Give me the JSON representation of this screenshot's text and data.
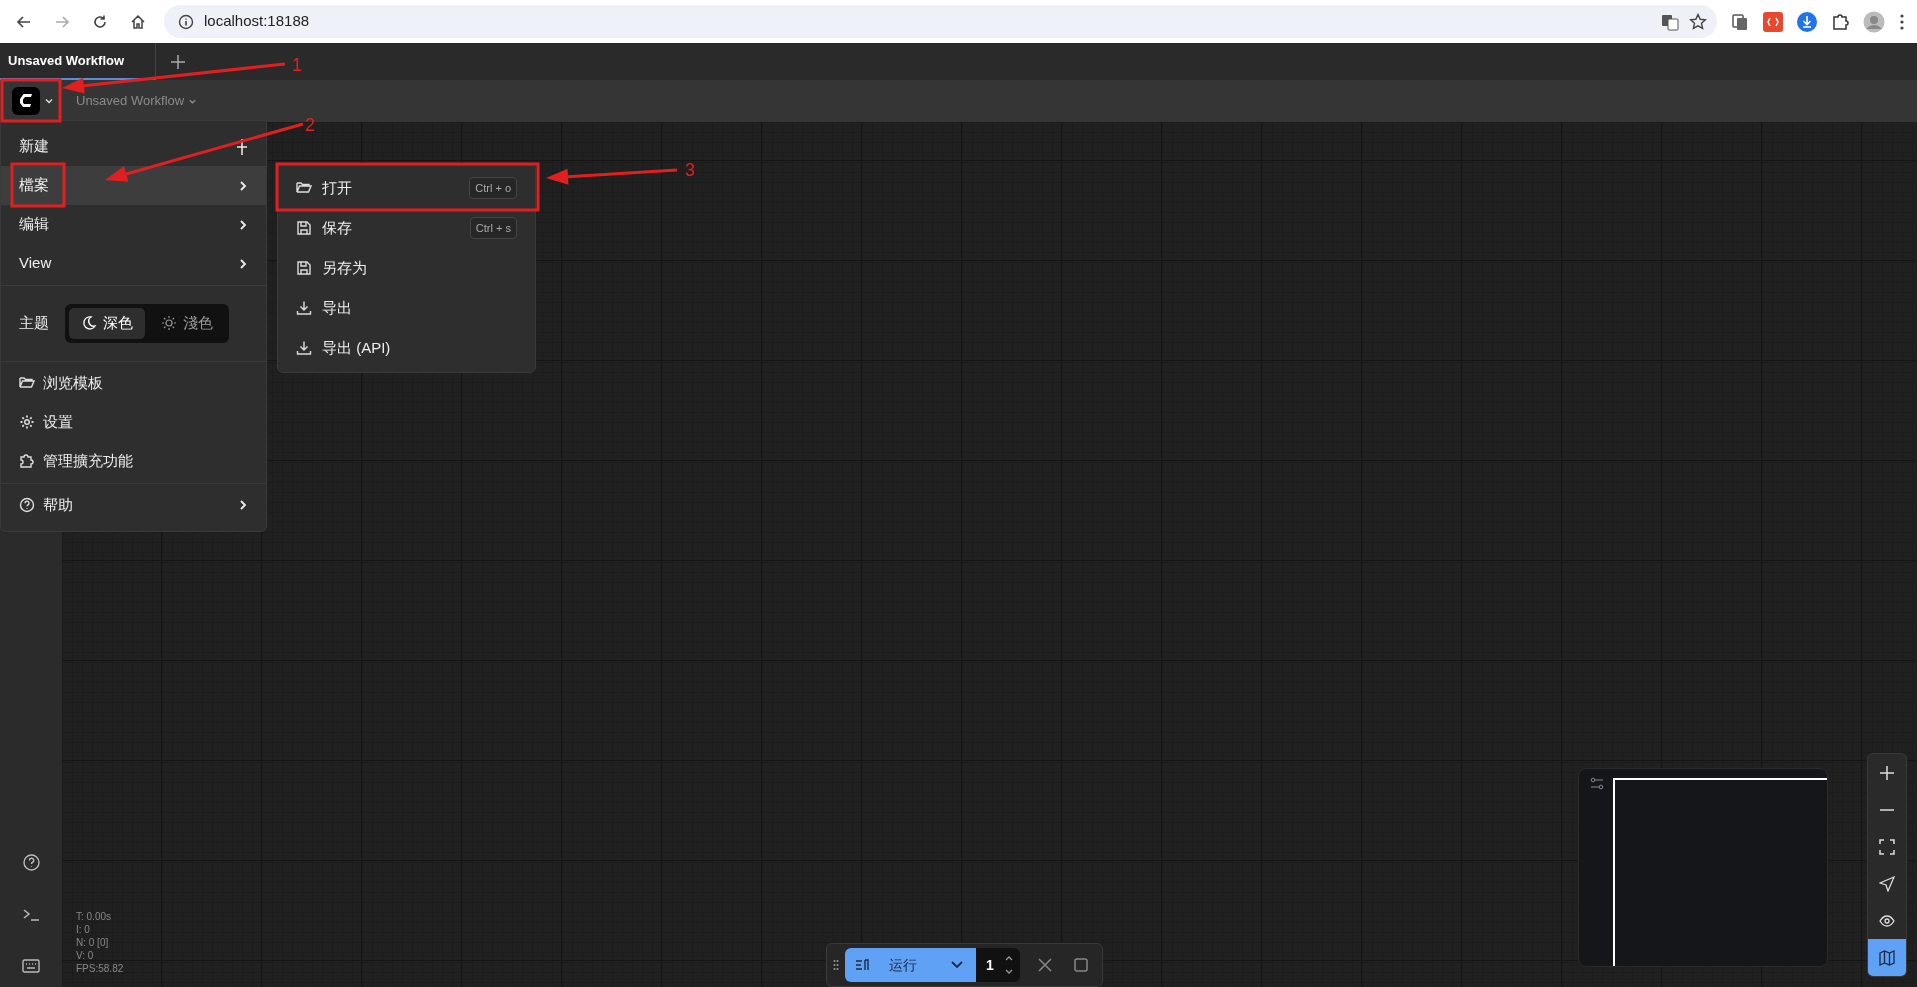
{
  "browser": {
    "url": "localhost:18188"
  },
  "tabs": [
    {
      "label": "Unsaved Workflow",
      "selected": true
    }
  ],
  "top_bar": {
    "workflow_title": "Unsaved Workflow"
  },
  "main_menu": {
    "groups": [
      {
        "items": [
          {
            "kind": "new",
            "label": "新建",
            "selected": false
          },
          {
            "kind": "submenu",
            "label": "檔案",
            "selected": true
          },
          {
            "kind": "submenu",
            "label": "编辑",
            "selected": false
          },
          {
            "kind": "submenu",
            "label": "View",
            "selected": false
          }
        ]
      },
      {
        "theme": {
          "label": "主题",
          "options": [
            {
              "kind": "dark",
              "label": "深色",
              "selected": true
            },
            {
              "kind": "light",
              "label": "淺色",
              "selected": false
            }
          ]
        }
      },
      {
        "items": [
          {
            "kind": "templates",
            "label": "浏览模板",
            "selected": false
          },
          {
            "kind": "settings",
            "label": "设置",
            "selected": false
          },
          {
            "kind": "extensions",
            "label": "管理擴充功能",
            "selected": false
          }
        ]
      },
      {
        "items": [
          {
            "kind": "help",
            "label": "帮助",
            "selected": false
          }
        ]
      }
    ]
  },
  "file_submenu": {
    "items": [
      {
        "kind": "open",
        "label": "打开",
        "shortcut": "Ctrl + o"
      },
      {
        "kind": "save",
        "label": "保存",
        "shortcut": "Ctrl + s"
      },
      {
        "kind": "saveas",
        "label": "另存为"
      },
      {
        "kind": "export",
        "label": "导出"
      },
      {
        "kind": "export",
        "label": "导出 (API)"
      }
    ]
  },
  "stats": [
    "T: 0.00s",
    "I: 0",
    "N: 0 [0]",
    "V: 0",
    "FPS:58.82"
  ],
  "run_toolbar": {
    "run_label": "运行",
    "batch_count": "1"
  },
  "canvas_controls": [
    {
      "kind": "zoom-in",
      "active": false
    },
    {
      "kind": "zoom-out",
      "active": false
    },
    {
      "kind": "fit",
      "active": false
    },
    {
      "kind": "select",
      "active": false
    },
    {
      "kind": "visibility",
      "active": false
    },
    {
      "kind": "minimap",
      "active": true
    }
  ],
  "annotations": [
    {
      "label": "1"
    },
    {
      "label": "2"
    },
    {
      "label": "3"
    }
  ]
}
